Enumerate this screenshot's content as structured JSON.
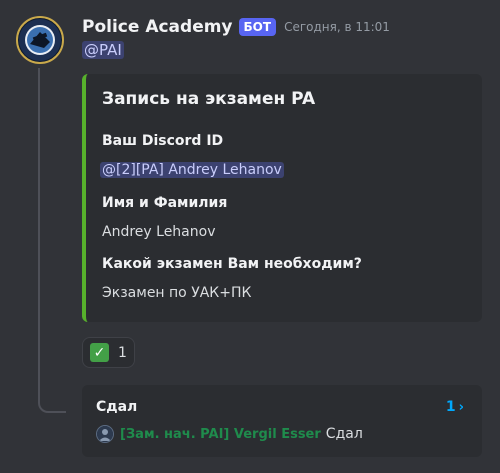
{
  "message": {
    "author": "Police Academy",
    "bot_tag": "БОТ",
    "timestamp": "Сегодня, в 11:01",
    "mention": "@PAI"
  },
  "embed": {
    "accent_color": "#57b12c",
    "title": "Запись на экзамен PA",
    "fields": [
      {
        "name": "Ваш Discord ID",
        "value": "@[2][PA] Andrey Lehanov"
      },
      {
        "name": "Имя и Фамилия",
        "value": "Andrey Lehanov"
      },
      {
        "name": "Какой экзамен Вам необходим?",
        "value": "Экзамен по УАК+ПК"
      }
    ]
  },
  "reaction": {
    "emoji": "check-mark-button-icon",
    "count": "1"
  },
  "thread": {
    "name": "Сдал",
    "message_count": "1",
    "last_author": "[Зам. нач. PAI] Vergil Esser",
    "last_message": "Сдал"
  },
  "colors": {
    "background": "#313338",
    "embed_background": "#2b2d31",
    "mention_background": "#3c4270",
    "bot_tag": "#5865f2",
    "link": "#00a8fc",
    "role_color": "#1f8b4c"
  }
}
